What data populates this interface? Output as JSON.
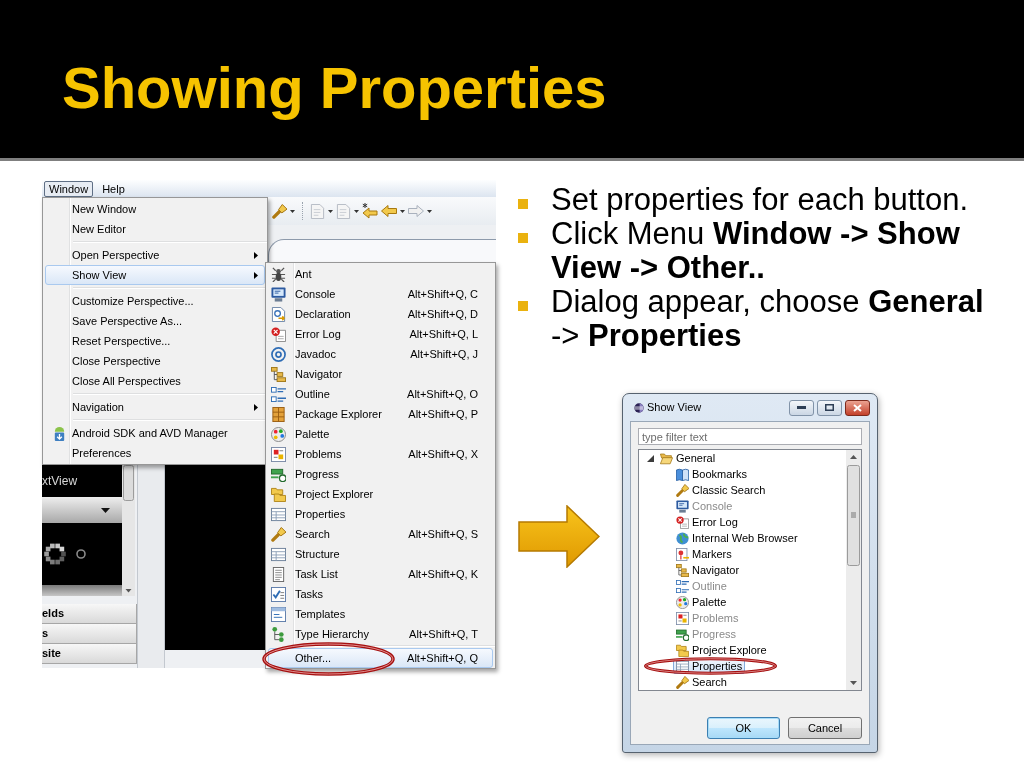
{
  "slide_title": "Showing Properties",
  "ide_screenshot": {
    "menu_bar": [
      {
        "label": "Window",
        "selected": true
      },
      {
        "label": "Help",
        "selected": false
      }
    ],
    "window_menu": [
      [
        {
          "label": "New Window",
          "selected": false,
          "has_submenu": false
        },
        {
          "label": "New Editor",
          "selected": false,
          "has_submenu": false
        }
      ],
      [
        {
          "label": "Open Perspective",
          "selected": false,
          "has_submenu": true
        },
        {
          "label": "Show View",
          "selected": true,
          "has_submenu": true
        }
      ],
      [
        {
          "label": "Customize Perspective...",
          "selected": false,
          "has_submenu": false
        },
        {
          "label": "Save Perspective As...",
          "selected": false,
          "has_submenu": false
        },
        {
          "label": "Reset Perspective...",
          "selected": false,
          "has_submenu": false
        },
        {
          "label": "Close Perspective",
          "selected": false,
          "has_submenu": false
        },
        {
          "label": "Close All Perspectives",
          "selected": false,
          "has_submenu": false
        }
      ],
      [
        {
          "label": "Navigation",
          "selected": false,
          "has_submenu": true
        }
      ],
      [
        {
          "label": "Android SDK and AVD Manager",
          "selected": false,
          "has_submenu": false
        },
        {
          "label": "Preferences",
          "selected": false,
          "has_submenu": false
        }
      ]
    ],
    "show_view_submenu": [
      [
        {
          "label": "Ant",
          "selected": false,
          "circled": false
        },
        {
          "label": "Console",
          "shortcut": "Alt+Shift+Q, C",
          "selected": false,
          "circled": false
        },
        {
          "label": "Declaration",
          "shortcut": "Alt+Shift+Q, D",
          "selected": false,
          "circled": false
        },
        {
          "label": "Error Log",
          "shortcut": "Alt+Shift+Q, L",
          "selected": false,
          "circled": false
        },
        {
          "label": "Javadoc",
          "shortcut": "Alt+Shift+Q, J",
          "selected": false,
          "circled": false
        },
        {
          "label": "Navigator",
          "selected": false,
          "circled": false
        },
        {
          "label": "Outline",
          "shortcut": "Alt+Shift+Q, O",
          "selected": false,
          "circled": false
        },
        {
          "label": "Package Explorer",
          "shortcut": "Alt+Shift+Q, P",
          "selected": false,
          "circled": false
        },
        {
          "label": "Palette",
          "selected": false,
          "circled": false
        },
        {
          "label": "Problems",
          "shortcut": "Alt+Shift+Q, X",
          "selected": false,
          "circled": false
        },
        {
          "label": "Progress",
          "selected": false,
          "circled": false
        },
        {
          "label": "Project Explorer",
          "selected": false,
          "circled": false
        },
        {
          "label": "Properties",
          "selected": false,
          "circled": false
        },
        {
          "label": "Search",
          "shortcut": "Alt+Shift+Q, S",
          "selected": false,
          "circled": false
        },
        {
          "label": "Structure",
          "selected": false,
          "circled": false
        },
        {
          "label": "Task List",
          "shortcut": "Alt+Shift+Q, K",
          "selected": false,
          "circled": false
        },
        {
          "label": "Tasks",
          "selected": false,
          "circled": false
        },
        {
          "label": "Templates",
          "selected": false,
          "circled": false
        },
        {
          "label": "Type Hierarchy",
          "shortcut": "Alt+Shift+Q, T",
          "selected": false,
          "circled": false
        }
      ],
      [
        {
          "label": "Other...",
          "shortcut": "Alt+Shift+Q, Q",
          "selected": true,
          "circled": true
        }
      ]
    ],
    "side_panel": {
      "preview_text": "xtView",
      "categories": [
        "elds",
        "s",
        "site"
      ]
    }
  },
  "bullets": [
    "Set properties for each button.",
    "Click Menu **Window -> Show View -> Other..**",
    "Dialog appear, choose **General** -> **Properties**"
  ],
  "show_view_dialog": {
    "title": "Show View",
    "filter": {
      "placeholder": "type filter text"
    },
    "tree": [
      {
        "label": "General",
        "expanded": true,
        "selected": false,
        "children": [
          {
            "label": "Bookmarks",
            "selected": false,
            "disabled": false,
            "circled": false
          },
          {
            "label": "Classic Search",
            "selected": false,
            "disabled": false,
            "circled": false
          },
          {
            "label": "Console",
            "selected": false,
            "disabled": true,
            "circled": false
          },
          {
            "label": "Error Log",
            "selected": false,
            "disabled": false,
            "circled": false
          },
          {
            "label": "Internal Web Browser",
            "selected": false,
            "disabled": false,
            "circled": false
          },
          {
            "label": "Markers",
            "selected": false,
            "disabled": false,
            "circled": false
          },
          {
            "label": "Navigator",
            "selected": false,
            "disabled": false,
            "circled": false
          },
          {
            "label": "Outline",
            "selected": false,
            "disabled": true,
            "circled": false
          },
          {
            "label": "Palette",
            "selected": false,
            "disabled": false,
            "circled": false
          },
          {
            "label": "Problems",
            "selected": false,
            "disabled": true,
            "circled": false
          },
          {
            "label": "Progress",
            "selected": false,
            "disabled": true,
            "circled": false
          },
          {
            "label": "Project Explore",
            "selected": false,
            "disabled": false,
            "circled": false
          },
          {
            "label": "Properties",
            "selected": true,
            "disabled": false,
            "circled": true
          },
          {
            "label": "Search",
            "selected": false,
            "disabled": false,
            "circled": false
          }
        ]
      }
    ],
    "buttons": [
      {
        "label": "OK",
        "default": true
      },
      {
        "label": "Cancel",
        "default": false
      }
    ]
  }
}
